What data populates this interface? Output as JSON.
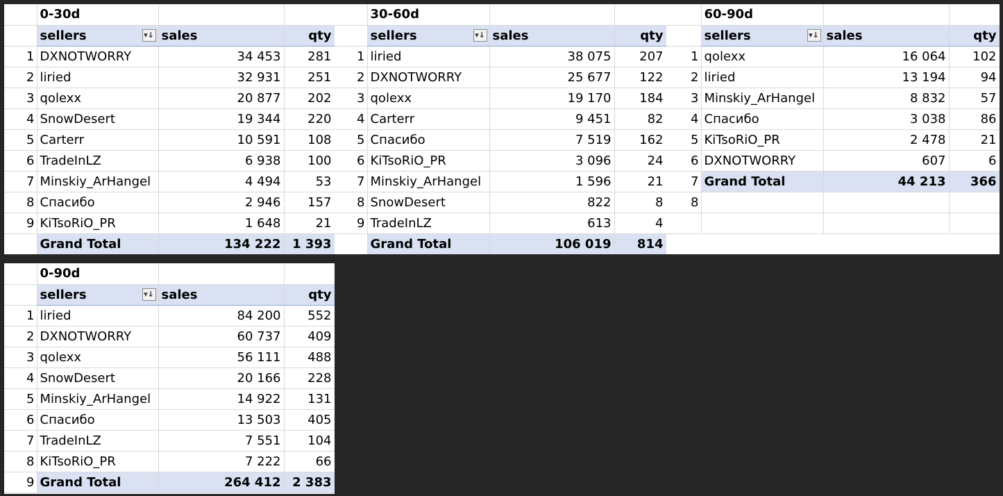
{
  "tables": [
    {
      "title": "0-30d",
      "headers": {
        "sellers": "sellers",
        "sales": "sales",
        "qty": "qty"
      },
      "rows": [
        {
          "n": "1",
          "seller": "DXNOTWORRY",
          "sales": "34 453",
          "qty": "281"
        },
        {
          "n": "2",
          "seller": "liried",
          "sales": "32 931",
          "qty": "251"
        },
        {
          "n": "3",
          "seller": "qolexx",
          "sales": "20 877",
          "qty": "202"
        },
        {
          "n": "4",
          "seller": "SnowDesert",
          "sales": "19 344",
          "qty": "220"
        },
        {
          "n": "5",
          "seller": "Carterr",
          "sales": "10 591",
          "qty": "108"
        },
        {
          "n": "6",
          "seller": "TradeInLZ",
          "sales": "6 938",
          "qty": "100"
        },
        {
          "n": "7",
          "seller": "Minskiy_ArHangel",
          "sales": "4 494",
          "qty": "53"
        },
        {
          "n": "8",
          "seller": "Спасибо",
          "sales": "2 946",
          "qty": "157"
        },
        {
          "n": "9",
          "seller": "KiTsoRiO_PR",
          "sales": "1 648",
          "qty": "21"
        }
      ],
      "total": {
        "n": "",
        "label": "Grand Total",
        "sales": "134 222",
        "qty": "1 393"
      },
      "extra_rows": []
    },
    {
      "title": "30-60d",
      "headers": {
        "sellers": "sellers",
        "sales": "sales",
        "qty": "qty"
      },
      "rows": [
        {
          "n": "1",
          "seller": "liried",
          "sales": "38 075",
          "qty": "207"
        },
        {
          "n": "2",
          "seller": "DXNOTWORRY",
          "sales": "25 677",
          "qty": "122"
        },
        {
          "n": "3",
          "seller": "qolexx",
          "sales": "19 170",
          "qty": "184"
        },
        {
          "n": "4",
          "seller": "Carterr",
          "sales": "9 451",
          "qty": "82"
        },
        {
          "n": "5",
          "seller": "Спасибо",
          "sales": "7 519",
          "qty": "162"
        },
        {
          "n": "6",
          "seller": "KiTsoRiO_PR",
          "sales": "3 096",
          "qty": "24"
        },
        {
          "n": "7",
          "seller": "Minskiy_ArHangel",
          "sales": "1 596",
          "qty": "21"
        },
        {
          "n": "8",
          "seller": "SnowDesert",
          "sales": "822",
          "qty": "8"
        },
        {
          "n": "9",
          "seller": "TradeInLZ",
          "sales": "613",
          "qty": "4"
        }
      ],
      "total": {
        "n": "",
        "label": "Grand Total",
        "sales": "106 019",
        "qty": "814"
      },
      "extra_rows": []
    },
    {
      "title": "60-90d",
      "headers": {
        "sellers": "sellers",
        "sales": "sales",
        "qty": "qty"
      },
      "rows": [
        {
          "n": "1",
          "seller": "qolexx",
          "sales": "16 064",
          "qty": "102"
        },
        {
          "n": "2",
          "seller": "liried",
          "sales": "13 194",
          "qty": "94"
        },
        {
          "n": "3",
          "seller": "Minskiy_ArHangel",
          "sales": "8 832",
          "qty": "57"
        },
        {
          "n": "4",
          "seller": "Спасибо",
          "sales": "3 038",
          "qty": "86"
        },
        {
          "n": "5",
          "seller": "KiTsoRiO_PR",
          "sales": "2 478",
          "qty": "21"
        },
        {
          "n": "6",
          "seller": "DXNOTWORRY",
          "sales": "607",
          "qty": "6"
        }
      ],
      "total": {
        "n": "7",
        "label": "Grand Total",
        "sales": "44 213",
        "qty": "366"
      },
      "extra_rows": [
        {
          "n": "8"
        },
        {
          "n": ""
        }
      ]
    },
    {
      "title": "0-90d",
      "headers": {
        "sellers": "sellers",
        "sales": "sales",
        "qty": "qty"
      },
      "rows": [
        {
          "n": "1",
          "seller": "liried",
          "sales": "84 200",
          "qty": "552"
        },
        {
          "n": "2",
          "seller": "DXNOTWORRY",
          "sales": "60 737",
          "qty": "409"
        },
        {
          "n": "3",
          "seller": "qolexx",
          "sales": "56 111",
          "qty": "488"
        },
        {
          "n": "4",
          "seller": "SnowDesert",
          "sales": "20 166",
          "qty": "228"
        },
        {
          "n": "5",
          "seller": "Minskiy_ArHangel",
          "sales": "14 922",
          "qty": "131"
        },
        {
          "n": "6",
          "seller": "Спасибо",
          "sales": "13 503",
          "qty": "405"
        },
        {
          "n": "7",
          "seller": "TradeInLZ",
          "sales": "7 551",
          "qty": "104"
        },
        {
          "n": "8",
          "seller": "KiTsoRiO_PR",
          "sales": "7 222",
          "qty": "66"
        }
      ],
      "total": {
        "n": "9",
        "label": "Grand Total",
        "sales": "264 412",
        "qty": "2 383"
      },
      "extra_rows": []
    }
  ],
  "icons": {
    "filter_sort": "filter-sort-icon"
  },
  "colors": {
    "header_fill": "#d9e1f2",
    "background": "#262626"
  }
}
